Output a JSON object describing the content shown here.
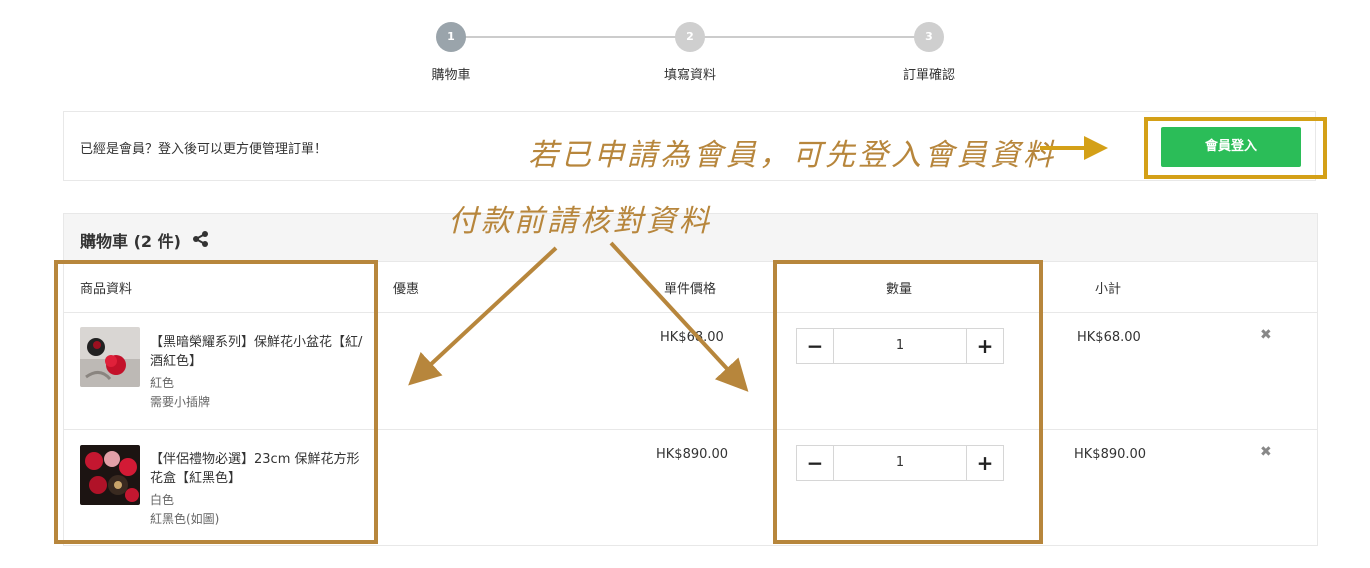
{
  "stepper": {
    "steps": [
      {
        "number": "1",
        "label": "購物車"
      },
      {
        "number": "2",
        "label": "填寫資料"
      },
      {
        "number": "3",
        "label": "訂單確認"
      }
    ]
  },
  "member_bar": {
    "text": "已經是會員？登入後可以更方便管理訂單！",
    "login_label": "會員登入"
  },
  "cart": {
    "title": "購物車 (2 件)",
    "columns": {
      "product": "商品資料",
      "discount": "優惠",
      "unit_price": "單件價格",
      "quantity": "數量",
      "subtotal": "小計"
    },
    "items": [
      {
        "name": "【黑暗榮耀系列】保鮮花小盆花【紅/酒紅色】",
        "variant1": "紅色",
        "variant2": "需要小插牌",
        "unit_price": "HK$68.00",
        "quantity": "1",
        "subtotal": "HK$68.00",
        "minus": "−",
        "plus": "+",
        "remove": "✖"
      },
      {
        "name": "【伴侶禮物必選】23cm 保鮮花方形花盒【紅黑色】",
        "variant1": "白色",
        "variant2": "紅黑色(如圖)",
        "unit_price": "HK$890.00",
        "quantity": "1",
        "subtotal": "HK$890.00",
        "minus": "−",
        "plus": "+",
        "remove": "✖"
      }
    ]
  },
  "annotations": {
    "note_login": "若已申請為會員，可先登入會員資料",
    "note_check": "付款前請核對資料"
  },
  "colors": {
    "accent_green": "#2bbd58",
    "annotation": "#b7863c",
    "highlight_box": "#d4a017",
    "step_active": "#9aa4ab"
  },
  "icons": {
    "share": "share-icon",
    "remove": "close-icon",
    "minus": "minus-icon",
    "plus": "plus-icon"
  }
}
